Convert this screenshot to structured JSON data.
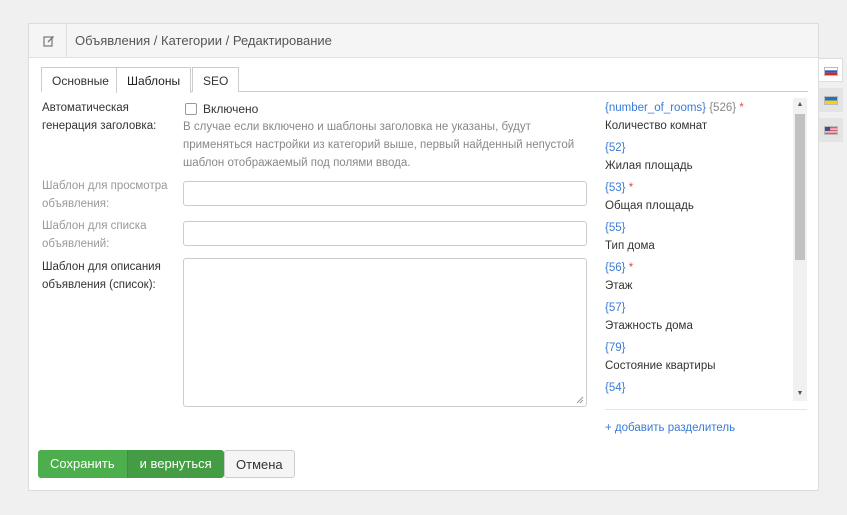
{
  "header": {
    "title": "Объявления / Категории / Редактирование",
    "icon": "edit-icon"
  },
  "tabs": [
    {
      "label": "Основные",
      "active": false
    },
    {
      "label": "Шаблоны",
      "active": true
    },
    {
      "label": "SEO",
      "active": false
    }
  ],
  "form": {
    "autogen_label": "Автоматическая генерация заголовка:",
    "autogen_checkbox_label": "Включено",
    "autogen_checked": false,
    "autogen_help": "В случае если включено и шаблоны заголовка не указаны, будут применяться настройки из категорий выше, первый найденный непустой шаблон отображаемый под полями ввода.",
    "view_template_label": "Шаблон для просмотра объявления:",
    "view_template_value": "",
    "list_template_label": "Шаблон для списка объявлений:",
    "list_template_value": "",
    "desc_template_label": "Шаблон для описания объявления (список):",
    "desc_template_value": ""
  },
  "variables": [
    {
      "key": "{number_of_rooms}",
      "num": "{526}",
      "required": true,
      "label": "Количество комнат"
    },
    {
      "key": "{52}",
      "num": "",
      "required": false,
      "label": "Жилая площадь"
    },
    {
      "key": "{53}",
      "num": "",
      "required": true,
      "label": "Общая площадь"
    },
    {
      "key": "{55}",
      "num": "",
      "required": false,
      "label": "Тип дома"
    },
    {
      "key": "{56}",
      "num": "",
      "required": true,
      "label": "Этаж"
    },
    {
      "key": "{57}",
      "num": "",
      "required": false,
      "label": "Этажность дома"
    },
    {
      "key": "{79}",
      "num": "",
      "required": false,
      "label": "Состояние квартиры"
    },
    {
      "key": "{54}",
      "num": "",
      "required": false,
      "label": ""
    }
  ],
  "add_separator": "+ добавить разделитель",
  "buttons": {
    "save": "Сохранить",
    "save_return": "и вернуться",
    "cancel": "Отмена"
  },
  "languages": [
    {
      "name": "ru-flag-icon",
      "active": true
    },
    {
      "name": "ua-flag-icon",
      "active": false
    },
    {
      "name": "us-flag-icon",
      "active": false
    }
  ],
  "colors": {
    "accent_green": "#4cae4c",
    "link_blue": "#3a7bd5",
    "required_red": "#d9534f"
  }
}
